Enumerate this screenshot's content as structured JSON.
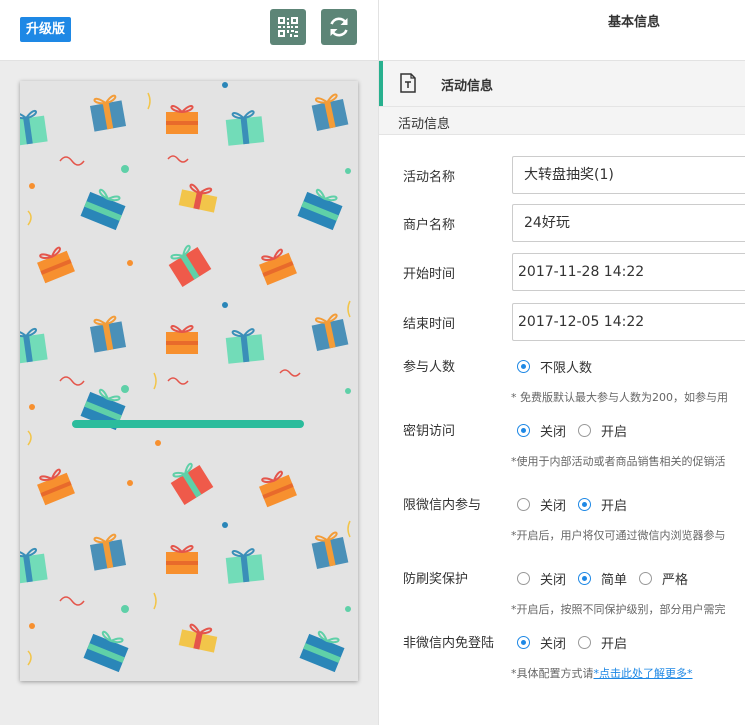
{
  "toolbar": {
    "upgrade_badge": "升级版",
    "qr_icon": "qr-code-icon",
    "refresh_icon": "refresh-icon"
  },
  "header": {
    "title": "基本信息"
  },
  "section": {
    "title": "活动信息",
    "icon": "document-icon",
    "subtitle": "活动信息"
  },
  "form": {
    "activity_name": {
      "label": "活动名称",
      "value": "大转盘抽奖(1)"
    },
    "merchant_name": {
      "label": "商户名称",
      "value": "24好玩"
    },
    "start_time": {
      "label": "开始时间",
      "value": "2017-11-28 14:22"
    },
    "end_time": {
      "label": "结束时间",
      "value": "2017-12-05 14:22"
    },
    "participants": {
      "label": "参与人数",
      "option_unlimited": "不限人数",
      "note": "* 免费版默认最大参与人数为200，如参与用"
    },
    "key_access": {
      "label": "密钥访问",
      "option_off": "关闭",
      "option_on": "开启",
      "note": "*使用于内部活动或者商品销售相关的促销活"
    },
    "wechat_only": {
      "label": "限微信内参与",
      "option_off": "关闭",
      "option_on": "开启",
      "note": "*开启后，用户将仅可通过微信内浏览器参与"
    },
    "anti_fraud": {
      "label": "防刷奖保护",
      "option_off": "关闭",
      "option_simple": "简单",
      "option_strict": "严格",
      "note": "*开启后，按照不同保护级别，部分用户需完"
    },
    "non_wechat_login": {
      "label": "非微信内免登陆",
      "option_off": "关闭",
      "option_on": "开启",
      "note_prefix": "*具体配置方式请",
      "note_link": "*点击此处了解更多*"
    }
  },
  "colors": {
    "accent_green": "#27b08e",
    "radio_blue": "#1e88e5",
    "badge_blue": "#1e88e5",
    "toolbar_icon_bg": "#5d8577",
    "preview_bar": "#2bbc9c"
  }
}
